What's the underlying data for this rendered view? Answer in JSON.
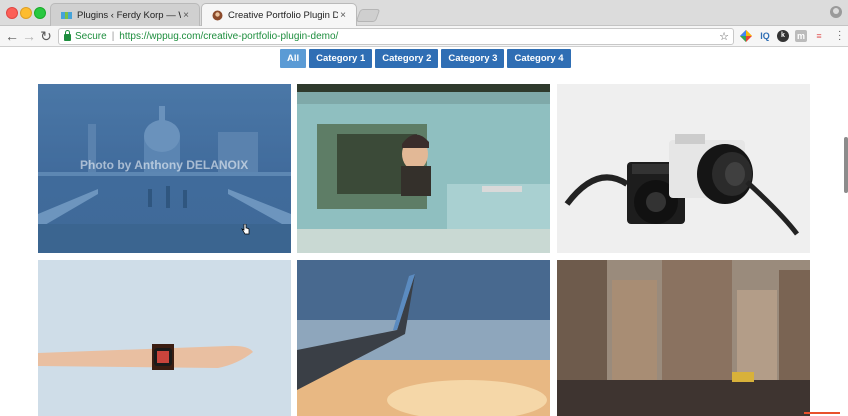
{
  "browser": {
    "tabs": [
      {
        "title": "Plugins ‹ Ferdy Korp — WordPress",
        "close": "×",
        "active": false
      },
      {
        "title": "Creative Portfolio Plugin Demo",
        "close": "×",
        "active": true
      }
    ],
    "omnibox": {
      "secure_label": "Secure",
      "separator": "|",
      "url_domain": "https://wppug.com",
      "url_path": "/creative-portfolio-plugin-demo/"
    },
    "nav": {
      "back": "←",
      "forward": "→",
      "reload": "↻",
      "star": "☆"
    },
    "extensions": [
      {
        "name": "gmail-icon",
        "glyph": "◆",
        "color": "#ea4335"
      },
      {
        "name": "iq-icon",
        "glyph": "IQ",
        "color": "#2f6eb4"
      },
      {
        "name": "dark-circle-icon",
        "glyph": "●",
        "color": "#333333"
      },
      {
        "name": "m-icon",
        "glyph": "m",
        "color": "#777777"
      },
      {
        "name": "tag-icon",
        "glyph": "⇌",
        "color": "#e05a5a"
      }
    ]
  },
  "portfolio": {
    "filters": [
      {
        "label": "All",
        "active": true
      },
      {
        "label": "Category 1",
        "active": false
      },
      {
        "label": "Category 2",
        "active": false
      },
      {
        "label": "Category 3",
        "active": false
      },
      {
        "label": "Category 4",
        "active": false
      }
    ],
    "watermark": "Photo by Anthony DELANOIX"
  },
  "colors": {
    "filter_button": "#2f6eb4",
    "filter_active": "#5b9bd5",
    "secure_green": "#1e8e3e"
  }
}
